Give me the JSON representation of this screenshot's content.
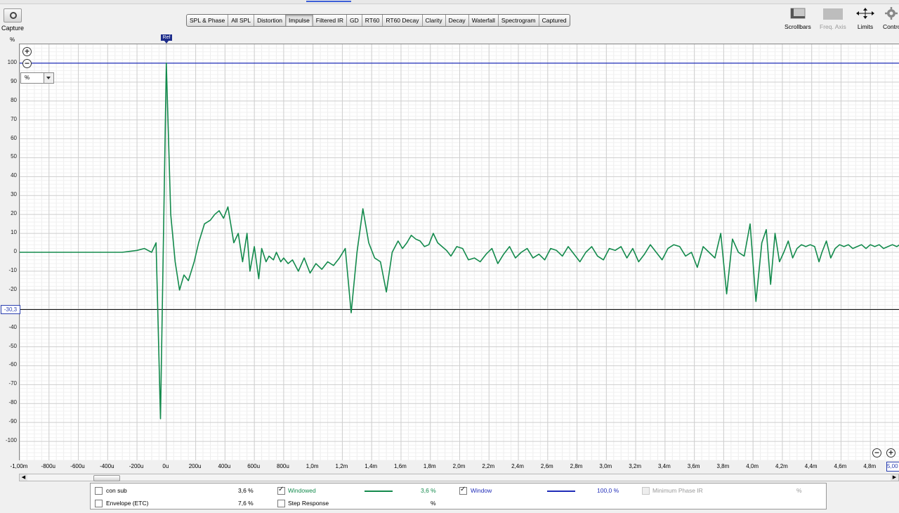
{
  "toolbar": {
    "capture_label": "Capture",
    "axis_unit_label": "%",
    "tabs": [
      {
        "label": "SPL & Phase",
        "active": false
      },
      {
        "label": "All SPL",
        "active": false
      },
      {
        "label": "Distortion",
        "active": false
      },
      {
        "label": "Impulse",
        "active": true
      },
      {
        "label": "Filtered IR",
        "active": false
      },
      {
        "label": "GD",
        "active": false
      },
      {
        "label": "RT60",
        "active": false
      },
      {
        "label": "RT60 Decay",
        "active": false
      },
      {
        "label": "Clarity",
        "active": false
      },
      {
        "label": "Decay",
        "active": false
      },
      {
        "label": "Waterfall",
        "active": false
      },
      {
        "label": "Spectrogram",
        "active": false
      },
      {
        "label": "Captured",
        "active": false
      }
    ],
    "right_tools": {
      "scrollbars": "Scrollbars",
      "freq_axis": "Freq. Axis",
      "limits": "Limits",
      "controls": "Contro"
    }
  },
  "plot": {
    "unit_select": "%",
    "ref_marker": "Ref",
    "cursor_value": "-30,3",
    "x_end_value": "5,00"
  },
  "chart_data": {
    "type": "line",
    "ylabel": "%",
    "ylim": [
      -110,
      110
    ],
    "xlim": [
      -1.0,
      5.0
    ],
    "x_unit": "ms",
    "y_ticks": [
      100,
      90,
      80,
      70,
      60,
      50,
      40,
      30,
      20,
      10,
      0,
      -10,
      -20,
      -30,
      -40,
      -50,
      -60,
      -70,
      -80,
      -90,
      -100
    ],
    "x_tick_labels": [
      "-1,00m",
      "-800u",
      "-600u",
      "-400u",
      "-200u",
      "0u",
      "200u",
      "400u",
      "600u",
      "800u",
      "1,0m",
      "1,2m",
      "1,4m",
      "1,6m",
      "1,8m",
      "2,0m",
      "2,2m",
      "2,4m",
      "2,6m",
      "2,8m",
      "3,0m",
      "3,2m",
      "3,4m",
      "3,6m",
      "3,8m",
      "4,0m",
      "4,2m",
      "4,4m",
      "4,6m",
      "4,8m"
    ],
    "x_tick_values": [
      -1.0,
      -0.8,
      -0.6,
      -0.4,
      -0.2,
      0.0,
      0.2,
      0.4,
      0.6,
      0.8,
      1.0,
      1.2,
      1.4,
      1.6,
      1.8,
      2.0,
      2.2,
      2.4,
      2.6,
      2.8,
      3.0,
      3.2,
      3.4,
      3.6,
      3.8,
      4.0,
      4.2,
      4.4,
      4.6,
      4.8
    ],
    "grid": true,
    "series": [
      {
        "name": "Windowed",
        "color": "#138a4c",
        "x": [
          -1.0,
          -0.3,
          -0.2,
          -0.15,
          -0.1,
          -0.07,
          -0.04,
          0.0,
          0.03,
          0.06,
          0.09,
          0.12,
          0.15,
          0.19,
          0.22,
          0.26,
          0.3,
          0.33,
          0.36,
          0.39,
          0.42,
          0.46,
          0.49,
          0.52,
          0.55,
          0.57,
          0.6,
          0.63,
          0.65,
          0.68,
          0.7,
          0.73,
          0.75,
          0.78,
          0.8,
          0.83,
          0.86,
          0.9,
          0.94,
          0.98,
          1.02,
          1.06,
          1.1,
          1.14,
          1.18,
          1.22,
          1.26,
          1.3,
          1.34,
          1.38,
          1.42,
          1.46,
          1.5,
          1.54,
          1.58,
          1.61,
          1.64,
          1.67,
          1.7,
          1.73,
          1.76,
          1.79,
          1.82,
          1.85,
          1.88,
          1.91,
          1.94,
          1.98,
          2.02,
          2.06,
          2.1,
          2.14,
          2.18,
          2.22,
          2.26,
          2.3,
          2.34,
          2.38,
          2.42,
          2.46,
          2.5,
          2.54,
          2.58,
          2.62,
          2.66,
          2.7,
          2.74,
          2.78,
          2.82,
          2.86,
          2.9,
          2.94,
          2.98,
          3.02,
          3.06,
          3.1,
          3.14,
          3.18,
          3.22,
          3.26,
          3.3,
          3.34,
          3.38,
          3.42,
          3.46,
          3.5,
          3.54,
          3.58,
          3.62,
          3.66,
          3.7,
          3.74,
          3.78,
          3.82,
          3.86,
          3.9,
          3.94,
          3.98,
          4.02,
          4.06,
          4.09,
          4.12,
          4.15,
          4.18,
          4.21,
          4.24,
          4.27,
          4.3,
          4.33,
          4.36,
          4.39,
          4.42,
          4.45,
          4.47,
          4.5,
          4.53,
          4.56,
          4.59,
          4.62,
          4.65,
          4.68,
          4.71,
          4.74,
          4.77,
          4.8,
          4.83,
          4.86,
          4.89,
          4.92,
          4.95,
          4.98,
          5.0
        ],
        "y": [
          0,
          0,
          1,
          2,
          0,
          5,
          -88,
          100,
          20,
          -5,
          -20,
          -12,
          -15,
          -5,
          5,
          15,
          17,
          20,
          22,
          18,
          24,
          5,
          10,
          -5,
          10,
          -10,
          3,
          -14,
          2,
          -5,
          -2,
          -4,
          0,
          -5,
          -3,
          -6,
          -4,
          -10,
          -3,
          -11,
          -6,
          -9,
          -5,
          -7,
          -3,
          2,
          -32,
          0,
          23,
          5,
          -3,
          -5,
          -21,
          0,
          6,
          2,
          5,
          9,
          7,
          6,
          3,
          4,
          10,
          5,
          3,
          1,
          -2,
          3,
          2,
          -4,
          -3,
          -5,
          -1,
          2,
          -6,
          -1,
          3,
          -3,
          0,
          2,
          -3,
          -1,
          -4,
          2,
          1,
          -2,
          3,
          -1,
          -5,
          0,
          3,
          -2,
          -4,
          2,
          1,
          3,
          -3,
          2,
          -5,
          -1,
          4,
          0,
          -4,
          2,
          4,
          3,
          -2,
          0,
          -8,
          3,
          0,
          -3,
          10,
          -22,
          7,
          0,
          -2,
          15,
          -26,
          5,
          12,
          -17,
          10,
          -5,
          0,
          6,
          -3,
          2,
          4,
          3,
          4,
          3,
          -5,
          0,
          6,
          -3,
          2,
          4,
          3,
          4,
          2,
          3,
          4,
          2,
          4,
          3,
          4,
          2,
          3,
          4,
          3,
          4
        ]
      }
    ]
  },
  "legend": {
    "con_sub": {
      "label": "con sub",
      "value": "3,6 %",
      "checked": false
    },
    "windowed": {
      "label": "Windowed",
      "value": "3,6 %",
      "checked": true,
      "color": "#138a4c"
    },
    "window": {
      "label": "Window",
      "value": "100,0 %",
      "checked": true,
      "color": "#1f2cb8"
    },
    "min_phase": {
      "label": "Minimum Phase IR",
      "value": "%",
      "checked": false,
      "disabled": true
    },
    "envelope": {
      "label": "Envelope (ETC)",
      "value": "7,6 %",
      "checked": false
    },
    "step": {
      "label": "Step Response",
      "value": "%",
      "checked": false
    }
  }
}
